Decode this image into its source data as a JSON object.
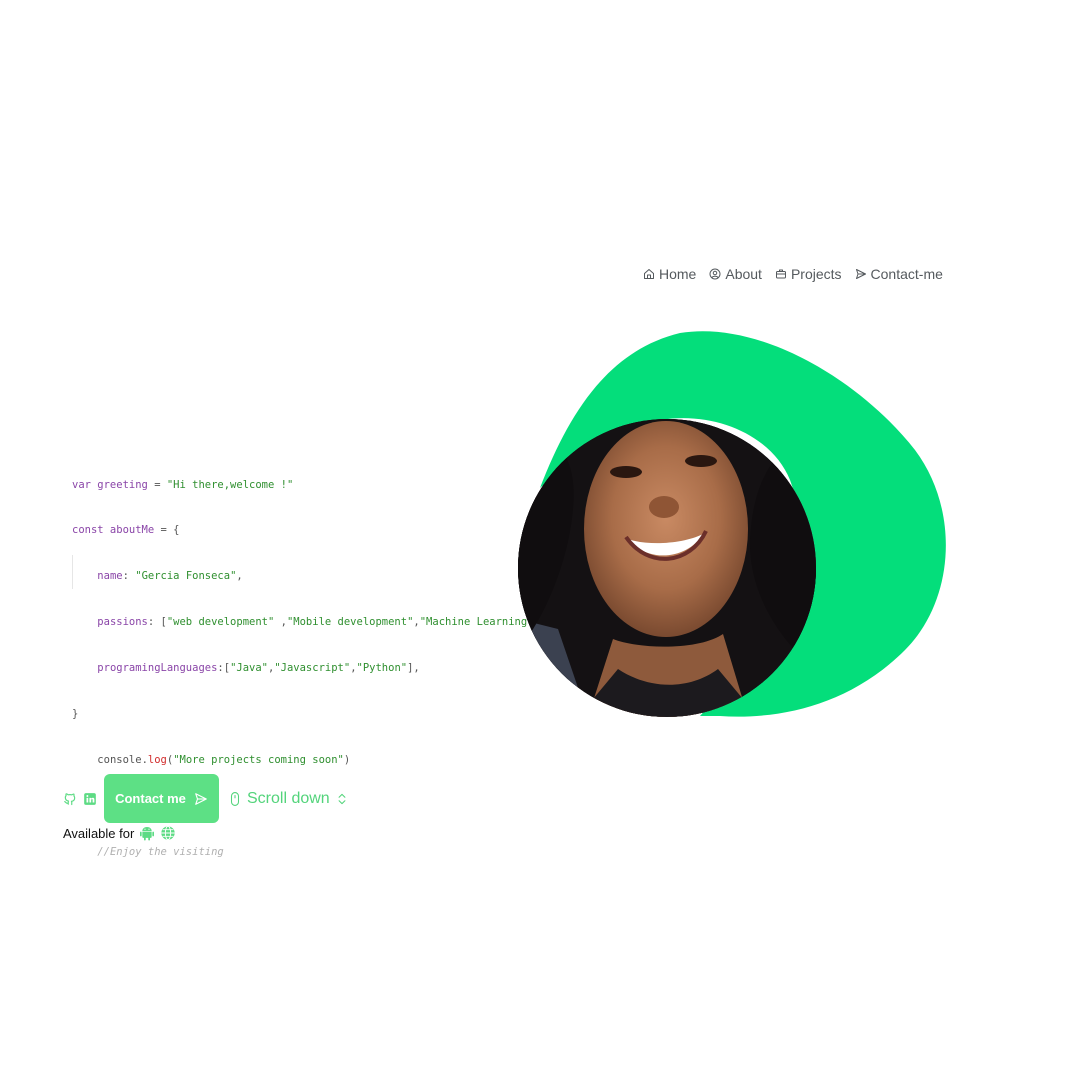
{
  "nav": {
    "items": [
      {
        "label": "Home",
        "icon": "home-icon"
      },
      {
        "label": "About",
        "icon": "user-circle-icon"
      },
      {
        "label": "Projects",
        "icon": "briefcase-icon"
      },
      {
        "label": "Contact-me",
        "icon": "send-icon"
      }
    ]
  },
  "code": {
    "line1": {
      "kw": "var",
      "name": " greeting",
      "op": " = ",
      "str": "\"Hi there,welcome !\""
    },
    "line2": {
      "kw": "const",
      "name": " aboutMe",
      "op": " = {"
    },
    "line3": {
      "key": "name",
      "op": ": ",
      "str": "\"Gercia Fonseca\"",
      "end": ","
    },
    "line4": {
      "key": "passions",
      "op": ": [",
      "s1": "\"web development\"",
      "sep1": " ,",
      "s2": "\"Mobile development\"",
      "sep2": ",",
      "s3": "\"Machine Learning\"",
      "end": "],"
    },
    "line5": {
      "key": "programingLanguages",
      "op": ":[",
      "s1": "\"Java\"",
      "sep1": ",",
      "s2": "\"Javascript\"",
      "sep2": ",",
      "s3": "\"Python\"",
      "end": "],"
    },
    "line6": {
      "close": "}"
    },
    "line7": {
      "obj": "console",
      "dot": ".",
      "fn": "log",
      "open": "(",
      "str": "\"More projects coming soon\"",
      "close": ")"
    },
    "line8": {
      "comment": "//Enjoy the visiting"
    }
  },
  "hero": {
    "accent_color": "#04de7b",
    "avatar_alt": "profile photo"
  },
  "actions": {
    "github_icon": "github-icon",
    "linkedin_icon": "linkedin-icon",
    "contact_label": "Contact me",
    "scroll_label": "Scroll down"
  },
  "available": {
    "label": "Available for",
    "icons": [
      "android-icon",
      "globe-icon"
    ]
  },
  "colors": {
    "accent": "#04de7b",
    "button": "#5de085",
    "link": "#53d47b"
  }
}
